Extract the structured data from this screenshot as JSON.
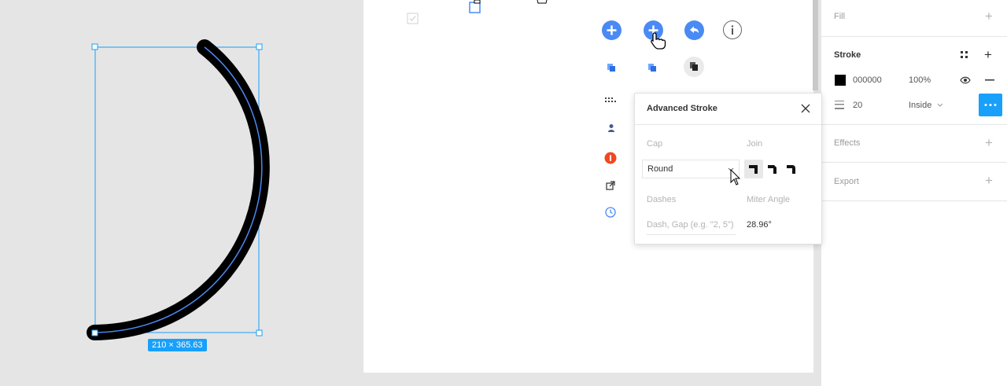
{
  "canvas": {
    "dimension_label": "210 × 365.63"
  },
  "toolbar": {
    "icons": [
      "add-circle-icon",
      "add-circle-hover-icon",
      "undo-icon",
      "info-icon"
    ]
  },
  "sidebar": {
    "fill_label": "Fill",
    "stroke_label": "Stroke",
    "stroke_color_hex": "000000",
    "stroke_opacity": "100%",
    "stroke_weight": "20",
    "stroke_position": "Inside",
    "effects_label": "Effects",
    "export_label": "Export"
  },
  "popup": {
    "title": "Advanced Stroke",
    "cap_label": "Cap",
    "cap_value": "Round",
    "join_label": "Join",
    "dashes_label": "Dashes",
    "dash_placeholder": "Dash, Gap (e.g. \"2, 5\")",
    "miter_label": "Miter Angle",
    "miter_value": "28.96°"
  },
  "colors": {
    "accent": "#18a0fb",
    "blue_button": "#4a8af4",
    "red_icon": "#f24822",
    "stroke": "#000000"
  }
}
